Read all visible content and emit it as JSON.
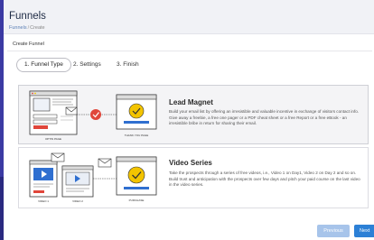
{
  "header": {
    "title": "Funnels",
    "breadcrumb": [
      "Funnels",
      "Create"
    ]
  },
  "subheader": {
    "title": "Create Funnel"
  },
  "steps": [
    {
      "label": "1. Funnel Type",
      "active": true
    },
    {
      "label": "2. Settings",
      "active": false
    },
    {
      "label": "3. Finish",
      "active": false
    }
  ],
  "funnel_types": [
    {
      "name": "Lead Magnet",
      "description": "Build your email list by offering an irresistible and valuable incentive in exchange of visitors contact info. Give away a freebie, a free one pager or a PDF cheat sheet or a free Report or a free eBook - an irresistible bribe in return for sharing their email.",
      "selected": true,
      "illustration_labels": [
        "OPTIN PAGE",
        "THANK YOU PAGE"
      ],
      "colors": {
        "check": "#f3c400",
        "arrow": "#e0463a"
      }
    },
    {
      "name": "Video Series",
      "description": "Take the prospects through a series of free videos, i.e., Video 1 on Day1, Video 2 on Day 2 and so on. Build trust and anticipation with the prospects over few days and pitch your paid course on the last video in the video series.",
      "selected": false,
      "illustration_labels": [
        "VIDEO 1",
        "VIDEO 2",
        "PURCHASE"
      ],
      "colors": {
        "video": "#2f6fd0",
        "check": "#f3c400"
      }
    }
  ],
  "footer": {
    "previous_label": "Previous",
    "next_label": "Next"
  },
  "colors": {
    "primary": "#2c80d6",
    "primary_disabled": "#a7c4ea",
    "sidebar": "#3b3aa3"
  }
}
